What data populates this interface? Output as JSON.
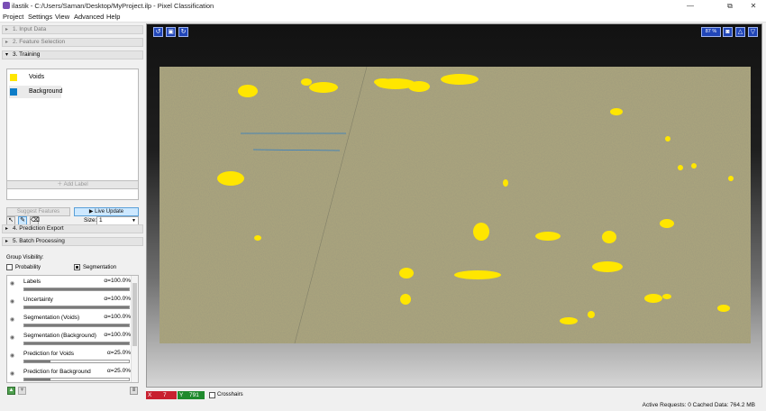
{
  "window": {
    "title": "ilastik - C:/Users/Saman/Desktop/MyProject.ilp - Pixel Classification",
    "minimize": "—",
    "maximize": "⧉",
    "close": "✕"
  },
  "menu": [
    "Project",
    "Settings",
    "View",
    "Advanced",
    "Help"
  ],
  "steps": {
    "input_data": "1. Input Data",
    "feature_selection": "2. Feature Selection",
    "training": "3. Training",
    "prediction_export": "4. Prediction Export",
    "batch_processing": "5. Batch Processing"
  },
  "labels": [
    {
      "name": "Voids",
      "color": "#ffe600"
    },
    {
      "name": "Background",
      "color": "#0d7dc8"
    }
  ],
  "training": {
    "add_label": "Add Label",
    "size_label": "Size:",
    "size_value": "1",
    "suggest_features": "Suggest Features",
    "live_update": "Live Update"
  },
  "group_visibility": {
    "title": "Group Visibility:",
    "probability": "Probability",
    "probability_checked": false,
    "segmentation": "Segmentation",
    "segmentation_checked": true
  },
  "layers": [
    {
      "name": "Labels",
      "alpha": "α=100.0%",
      "opacity": 1.0
    },
    {
      "name": "Uncertainty",
      "alpha": "α=100.0%",
      "opacity": 1.0
    },
    {
      "name": "Segmentation (Voids)",
      "alpha": "α=100.0%",
      "opacity": 1.0
    },
    {
      "name": "Segmentation (Background)",
      "alpha": "α=100.0%",
      "opacity": 1.0
    },
    {
      "name": "Prediction for Voids",
      "alpha": "α=25.0%",
      "opacity": 0.25
    },
    {
      "name": "Prediction for Background",
      "alpha": "α=25.0%",
      "opacity": 0.25
    }
  ],
  "viewer": {
    "zoom": "87 %"
  },
  "coords": {
    "x_label": "X",
    "x_value": "7",
    "y_label": "Y",
    "y_value": "791",
    "crosshairs": "Crosshairs"
  },
  "status": "Active Requests: 0 Cached Data: 764.2 MB",
  "colors": {
    "void": "#ffe600",
    "background_label": "#0d7dc8",
    "image_base": "#a9a37a",
    "viewer_button": "#2146b8"
  }
}
